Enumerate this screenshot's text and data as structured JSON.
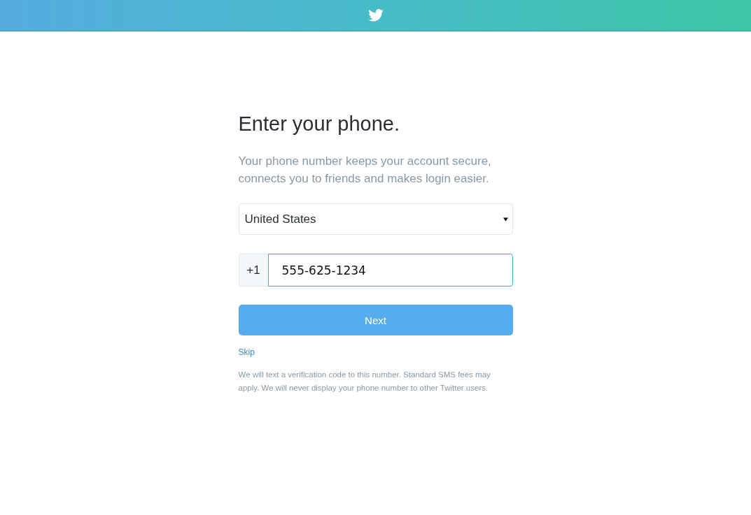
{
  "heading": "Enter your phone.",
  "intro": "Your phone number keeps your account secure, connects you to friends and makes login easier.",
  "country_select": {
    "value": "United States"
  },
  "phone": {
    "prefix": "+1",
    "value": "555-625-1234"
  },
  "next_button": "Next",
  "skip_link": "Skip",
  "disclaimer": "We will text a verification code to this number. Standard SMS fees may apply. We will never display your phone number to other Twitter users."
}
